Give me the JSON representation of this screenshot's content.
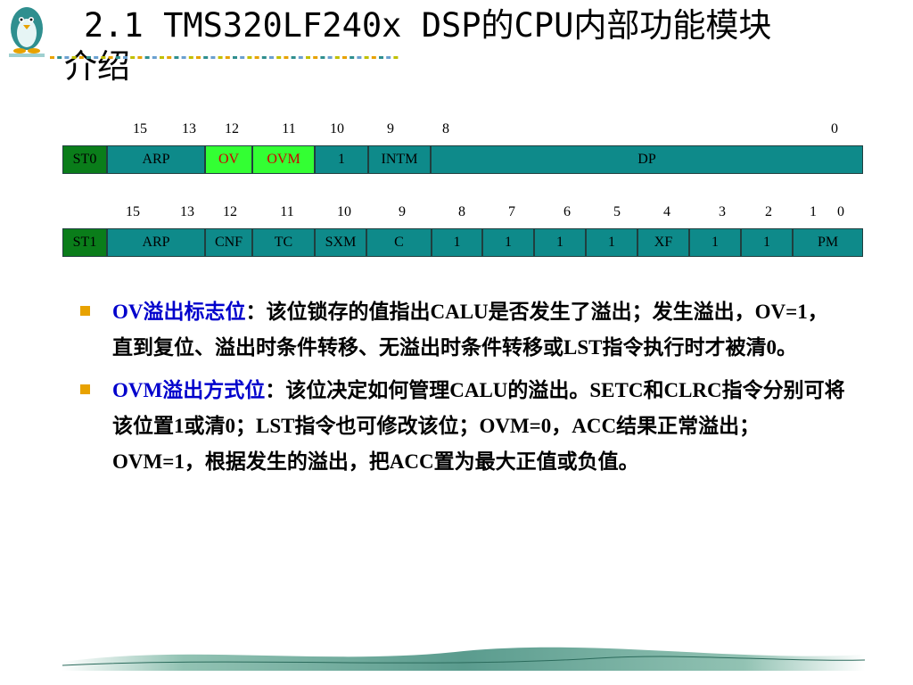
{
  "slide": {
    "title_line1": "2.1  TMS320LF240x DSP的CPU内部功能模块",
    "title_line2": "介绍"
  },
  "st0": {
    "bit_numbers": [
      "15",
      "13",
      "12",
      "11",
      "10",
      "9",
      "8",
      "0"
    ],
    "cells": [
      "ST0",
      "ARP",
      "OV",
      "OVM",
      "1",
      "INTM",
      "DP"
    ]
  },
  "st1": {
    "bit_numbers": [
      "15",
      "13",
      "12",
      "11",
      "10",
      "9",
      "8",
      "7",
      "6",
      "5",
      "4",
      "3",
      "2",
      "1",
      "0"
    ],
    "cells": [
      "ST1",
      "ARP",
      "CNF",
      "TC",
      "SXM",
      "C",
      "1",
      "1",
      "1",
      "1",
      "XF",
      "1",
      "1",
      "PM"
    ]
  },
  "bullets": [
    {
      "term": "OV溢出标志位",
      "text": "：该位锁存的值指出CALU是否发生了溢出；发生溢出，OV=1，直到复位、溢出时条件转移、无溢出时条件转移或LST指令执行时才被清0。"
    },
    {
      "term": "OVM溢出方式位",
      "text": "：该位决定如何管理CALU的溢出。SETC和CLRC指令分别可将该位置1或清0；LST指令也可修改该位；OVM=0，ACC结果正常溢出；OVM=1，根据发生的溢出，把ACC置为最大正值或负值。"
    }
  ],
  "colors": {
    "register_teal": "#0e8a8a",
    "register_green": "#0a7d1a",
    "highlight_lime": "#33ff33",
    "highlight_text": "#d00000",
    "term_blue": "#0000cc",
    "bullet_orange": "#e8a200"
  },
  "icons": {
    "logo": "penguin-logo",
    "footer": "decorative-landscape-banner"
  }
}
